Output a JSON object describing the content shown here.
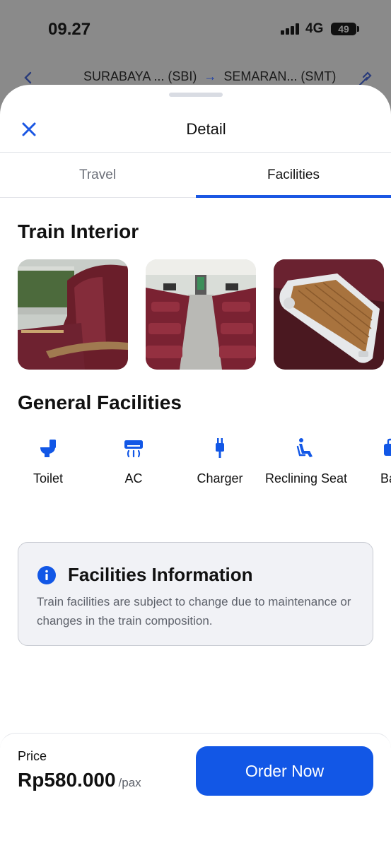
{
  "status_bar": {
    "time": "09.27",
    "network": "4G",
    "battery": "49"
  },
  "route": {
    "origin": "SURABAYA ... (SBI)",
    "arrow": "→",
    "destination": "SEMARAN... (SMT)"
  },
  "sheet": {
    "title": "Detail",
    "tabs": [
      {
        "label": "Travel",
        "active": false
      },
      {
        "label": "Facilities",
        "active": true
      }
    ]
  },
  "train_interior": {
    "title": "Train Interior",
    "photos": [
      "seat-side-view",
      "cabin-aisle-view",
      "fold-table-view"
    ]
  },
  "general_facilities": {
    "title": "General Facilities",
    "items": [
      {
        "label": "Toilet",
        "icon": "toilet-icon"
      },
      {
        "label": "AC",
        "icon": "ac-icon"
      },
      {
        "label": "Charger",
        "icon": "charger-icon"
      },
      {
        "label": "Reclining Seat",
        "icon": "reclining-seat-icon"
      },
      {
        "label": "Bag",
        "icon": "bag-icon"
      }
    ]
  },
  "facilities_info": {
    "title": "Facilities Information",
    "text": "Train facilities are subject to change due to maintenance or changes in the train composition."
  },
  "footer": {
    "price_label": "Price",
    "price": "Rp580.000",
    "unit": "/pax",
    "order_button": "Order Now"
  },
  "colors": {
    "accent": "#1257e6",
    "tab_indicator": "#1b57e3",
    "overlay": "#8a8a8a"
  }
}
